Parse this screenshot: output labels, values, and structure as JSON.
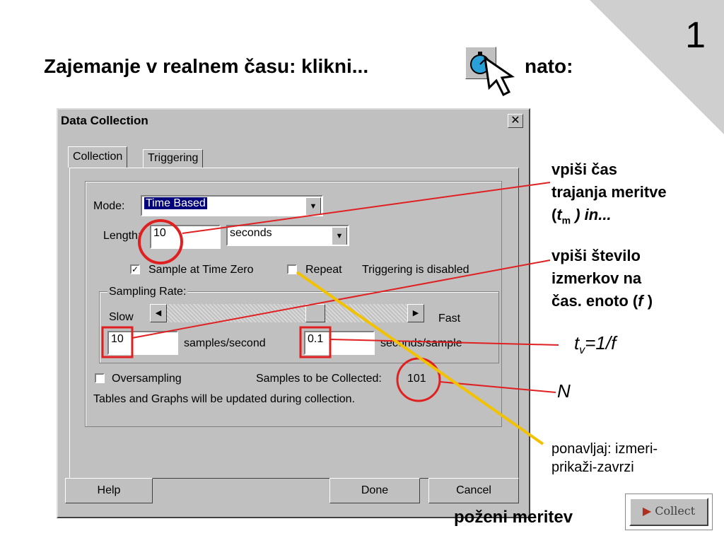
{
  "slide": {
    "number": "1",
    "title": "Zajemanje v realnem času: klikni...",
    "then": "nato:",
    "run_label": "poženi meritev",
    "collect_button": "Collect"
  },
  "dialog": {
    "title": "Data Collection",
    "close": "✕",
    "tabs": [
      "Collection",
      "Triggering"
    ],
    "mode_label": "Mode:",
    "mode_value": "Time Based",
    "length_label": "Length:",
    "length_value": "10",
    "length_unit": "seconds",
    "sample_zero": "Sample at Time Zero",
    "repeat": "Repeat",
    "triggering_status": "Triggering is disabled",
    "sampling_rate": "Sampling Rate:",
    "slow": "Slow",
    "fast": "Fast",
    "samples_value": "10",
    "samples_unit": "samples/second",
    "seconds_value": "0.1",
    "seconds_unit": "seconds/sample",
    "oversampling": "Oversampling",
    "to_collect_label": "Samples to be Collected:",
    "to_collect_value": "101",
    "info": "Tables and Graphs will be updated during collection.",
    "buttons": {
      "help": "Help",
      "done": "Done",
      "cancel": "Cancel"
    }
  },
  "annotations": {
    "note1_line1": "vpiši čas",
    "note1_line2": "trajanja meritve",
    "note1_line3a": "(",
    "note1_t": "t",
    "note1_sub": "m",
    "note1_line3b": " ) in...",
    "note2_line1": "vpiši število",
    "note2_line2": "izmerkov na",
    "note2_line3a": "čas. enoto (",
    "note2_f": "f",
    "note2_line3b": " )",
    "formula_t": "t",
    "formula_sub": "v",
    "formula_rest": "=1/f",
    "n_label": "N",
    "repeat_note1": "ponavljaj: izmeri-",
    "repeat_note2": "prikaži-zavrzi"
  },
  "colors": {
    "red": "#e02020",
    "yellow": "#f2c200",
    "titlebar": "#c0c0c0"
  }
}
